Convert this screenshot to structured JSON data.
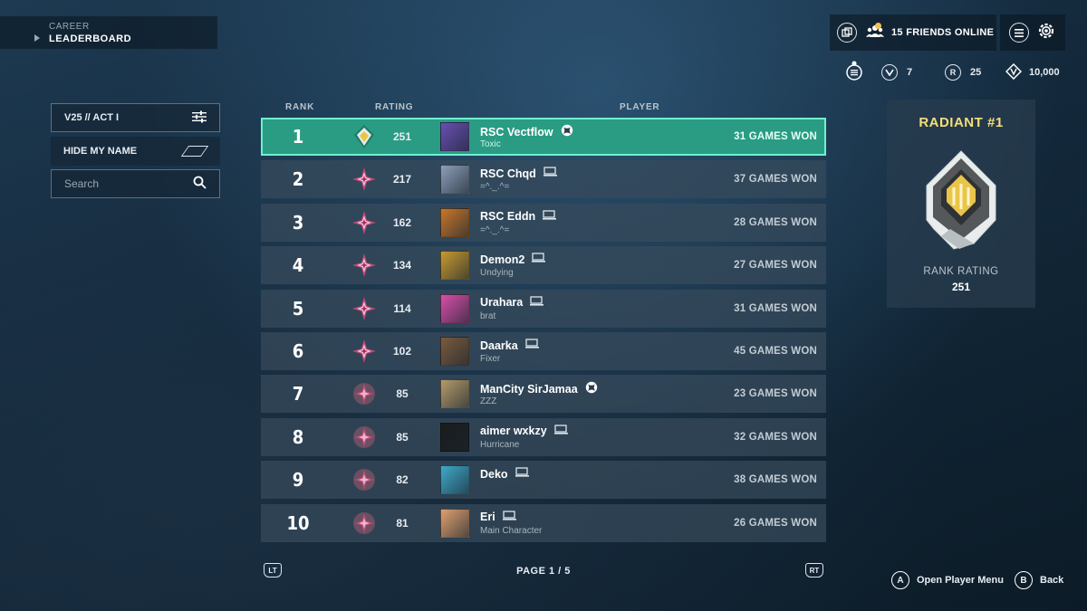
{
  "breadcrumb": {
    "parent": "CAREER",
    "current": "LEADERBOARD"
  },
  "header": {
    "friends_online": "15 FRIENDS ONLINE",
    "currencies": [
      {
        "icon": "kingdom-credits-icon",
        "value": "7"
      },
      {
        "icon": "radianite-icon",
        "glyph": "R",
        "value": "25"
      },
      {
        "icon": "valorant-points-icon",
        "value": "10,000"
      }
    ]
  },
  "filters": {
    "act_label": "V25 // ACT I",
    "hide_name_label": "HIDE MY NAME",
    "search_placeholder": "Search"
  },
  "table": {
    "headers": {
      "rank": "RANK",
      "rating": "RATING",
      "player": "PLAYER"
    },
    "rows": [
      {
        "rank": "1",
        "rating": "251",
        "name": "RSC Vectflow",
        "title": "Toxic",
        "platform": "xbox",
        "won": "31 GAMES WON",
        "badge": "radiant",
        "avatar": "#6a4fb3"
      },
      {
        "rank": "2",
        "rating": "217",
        "name": "RSC Chqd",
        "title": "=^._.^=",
        "platform": "pc",
        "won": "37 GAMES WON",
        "badge": "immortal",
        "avatar": "#8d9fb8"
      },
      {
        "rank": "3",
        "rating": "162",
        "name": "RSC Eddn",
        "title": "=^._.^=",
        "platform": "pc",
        "won": "28 GAMES WON",
        "badge": "immortal",
        "avatar": "#c8762a"
      },
      {
        "rank": "4",
        "rating": "134",
        "name": "Demon2",
        "title": "Undying",
        "platform": "pc",
        "won": "27 GAMES WON",
        "badge": "immortal",
        "avatar": "#c99a2e"
      },
      {
        "rank": "5",
        "rating": "114",
        "name": "Urahara",
        "title": "brat",
        "platform": "pc",
        "won": "31 GAMES WON",
        "badge": "immortal",
        "avatar": "#d94fa8"
      },
      {
        "rank": "6",
        "rating": "102",
        "name": "Daarka",
        "title": "Fixer",
        "platform": "pc",
        "won": "45 GAMES WON",
        "badge": "immortal",
        "avatar": "#7b5a3c"
      },
      {
        "rank": "7",
        "rating": "85",
        "name": "ManCity SirJamaa",
        "title": "ZZZ",
        "platform": "xbox",
        "won": "23 GAMES WON",
        "badge": "immortal-low",
        "avatar": "#b59a6a"
      },
      {
        "rank": "8",
        "rating": "85",
        "name": "aimer wxkzy",
        "title": "Hurricane",
        "platform": "pc",
        "won": "32 GAMES WON",
        "badge": "immortal-low",
        "avatar": "#1b1b1b"
      },
      {
        "rank": "9",
        "rating": "82",
        "name": "Deko",
        "title": "",
        "platform": "pc",
        "won": "38 GAMES WON",
        "badge": "immortal-low",
        "avatar": "#3fa9c9"
      },
      {
        "rank": "10",
        "rating": "81",
        "name": "Eri",
        "title": "Main Character",
        "platform": "pc",
        "won": "26 GAMES WON",
        "badge": "immortal-low",
        "avatar": "#e0a070"
      }
    ]
  },
  "pager": {
    "left_shoulder": "LT",
    "right_shoulder": "RT",
    "page_label": "PAGE 1 / 5"
  },
  "rank_panel": {
    "title": "RADIANT #1",
    "rating_label": "RANK RATING",
    "rating_value": "251"
  },
  "actions": [
    {
      "button": "A",
      "label": "Open Player Menu"
    },
    {
      "button": "B",
      "label": "Back"
    }
  ],
  "colors": {
    "highlight": "#2a9c83",
    "radiant_gold": "#f5df7a",
    "immortal": "#c0477a"
  }
}
